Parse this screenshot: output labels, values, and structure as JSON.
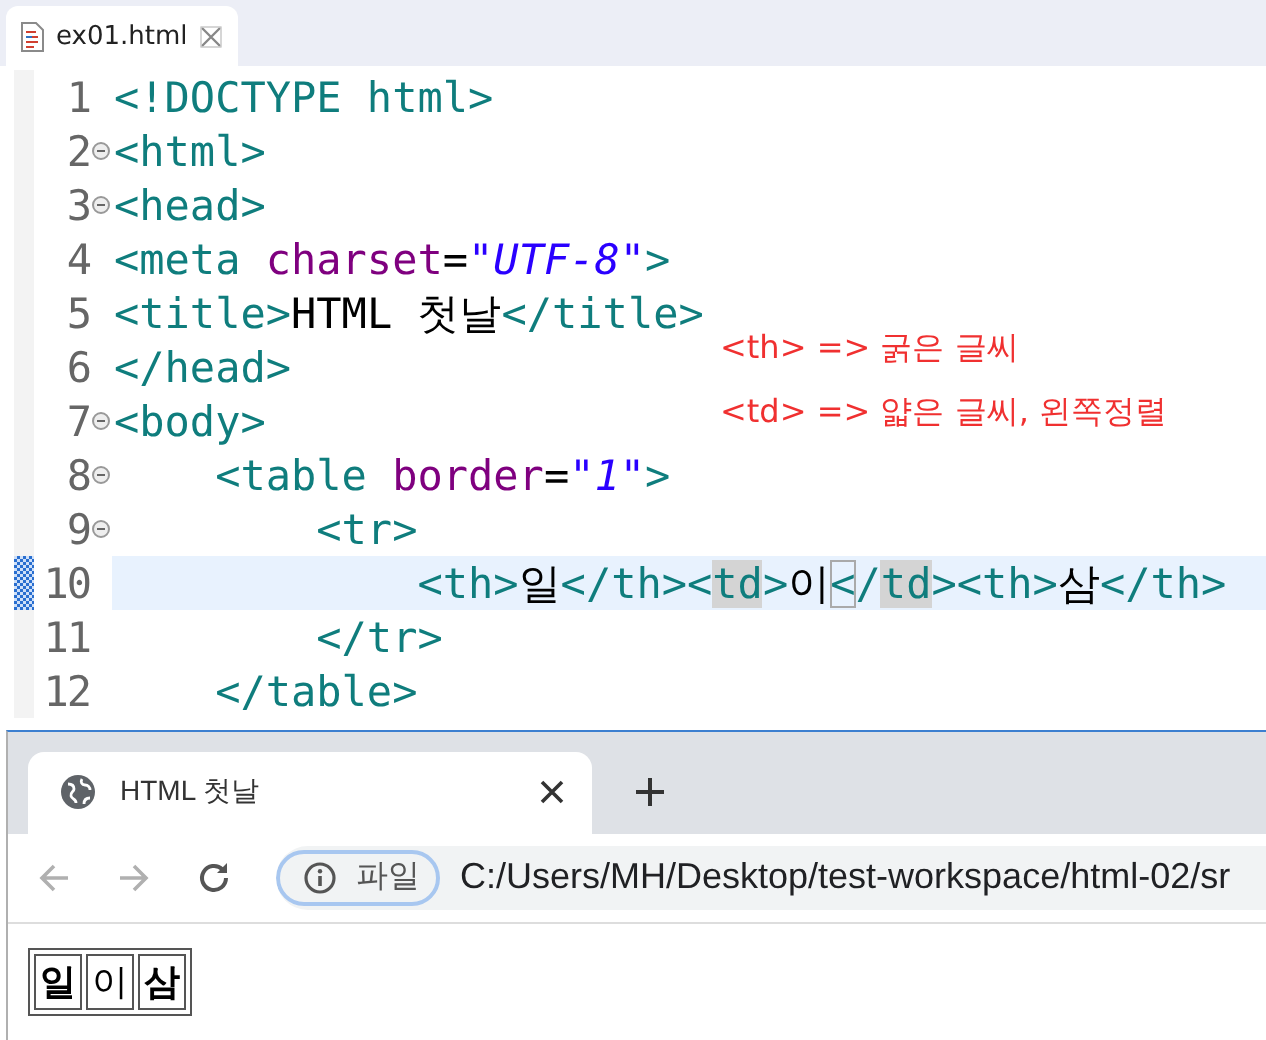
{
  "editor": {
    "tab": {
      "title": "ex01.html",
      "selected": true
    },
    "lines": [
      {
        "number": "1",
        "fold": false,
        "current": false,
        "tokens": [
          {
            "kind": "tag",
            "text": "<!DOCTYPE html>"
          }
        ]
      },
      {
        "number": "2",
        "fold": true,
        "current": false,
        "tokens": [
          {
            "kind": "tag",
            "text": "<html>"
          }
        ]
      },
      {
        "number": "3",
        "fold": true,
        "current": false,
        "tokens": [
          {
            "kind": "tag",
            "text": "<head>"
          }
        ]
      },
      {
        "number": "4",
        "fold": false,
        "current": false,
        "tokens": [
          {
            "kind": "tag",
            "text": "<meta "
          },
          {
            "kind": "attr",
            "text": "charset"
          },
          {
            "kind": "eq",
            "text": "="
          },
          {
            "kind": "str",
            "text": "\"UTF-8\""
          },
          {
            "kind": "tag",
            "text": ">"
          }
        ]
      },
      {
        "number": "5",
        "fold": false,
        "current": false,
        "tokens": [
          {
            "kind": "tag",
            "text": "<title>"
          },
          {
            "kind": "text",
            "text": "HTML 첫날"
          },
          {
            "kind": "tag",
            "text": "</title>"
          }
        ]
      },
      {
        "number": "6",
        "fold": false,
        "current": false,
        "tokens": [
          {
            "kind": "tag",
            "text": "</head>"
          }
        ]
      },
      {
        "number": "7",
        "fold": true,
        "current": false,
        "tokens": [
          {
            "kind": "tag",
            "text": "<body>"
          }
        ]
      },
      {
        "number": "8",
        "fold": true,
        "current": false,
        "tokens": [
          {
            "kind": "tag",
            "text": "    <table "
          },
          {
            "kind": "attr",
            "text": "border"
          },
          {
            "kind": "eq",
            "text": "="
          },
          {
            "kind": "str",
            "text": "\"1\""
          },
          {
            "kind": "tag",
            "text": ">"
          }
        ]
      },
      {
        "number": "9",
        "fold": true,
        "current": false,
        "tokens": [
          {
            "kind": "tag",
            "text": "        <tr>"
          }
        ]
      },
      {
        "number": "10",
        "fold": false,
        "current": true,
        "tokens": [
          {
            "kind": "tag",
            "text": "            <th>"
          },
          {
            "kind": "text",
            "text": "일"
          },
          {
            "kind": "tag",
            "text": "</th><"
          },
          {
            "kind": "occurrence",
            "text": "td"
          },
          {
            "kind": "tag",
            "text": ">"
          },
          {
            "kind": "text",
            "text": "이"
          },
          {
            "kind": "bracket",
            "text": "<"
          },
          {
            "kind": "tag",
            "text": "/"
          },
          {
            "kind": "occurrence",
            "text": "td"
          },
          {
            "kind": "tag",
            "text": "><th>"
          },
          {
            "kind": "text",
            "text": "삼"
          },
          {
            "kind": "tag",
            "text": "</th>"
          }
        ]
      },
      {
        "number": "11",
        "fold": false,
        "current": false,
        "tokens": [
          {
            "kind": "tag",
            "text": "        </tr>"
          }
        ]
      },
      {
        "number": "12",
        "fold": false,
        "current": false,
        "tokens": [
          {
            "kind": "tag",
            "text": "    </table>"
          }
        ]
      }
    ],
    "annotations": [
      "<th> => 굵은 글씨",
      "<td> => 얇은 글씨, 왼쪽정렬"
    ]
  },
  "browser": {
    "tab": {
      "title": "HTML 첫날",
      "selected": true
    },
    "nav": [
      {
        "kind": "back",
        "disabled": true
      },
      {
        "kind": "forward",
        "disabled": true
      },
      {
        "kind": "reload",
        "disabled": false
      }
    ],
    "address": {
      "chip": "파일",
      "url": "C:/Users/MH/Desktop/test-workspace/html-02/sr"
    },
    "table": {
      "cells": [
        {
          "kind": "th",
          "text": "일"
        },
        {
          "kind": "td",
          "text": "이"
        },
        {
          "kind": "th",
          "text": "삼"
        }
      ]
    }
  }
}
